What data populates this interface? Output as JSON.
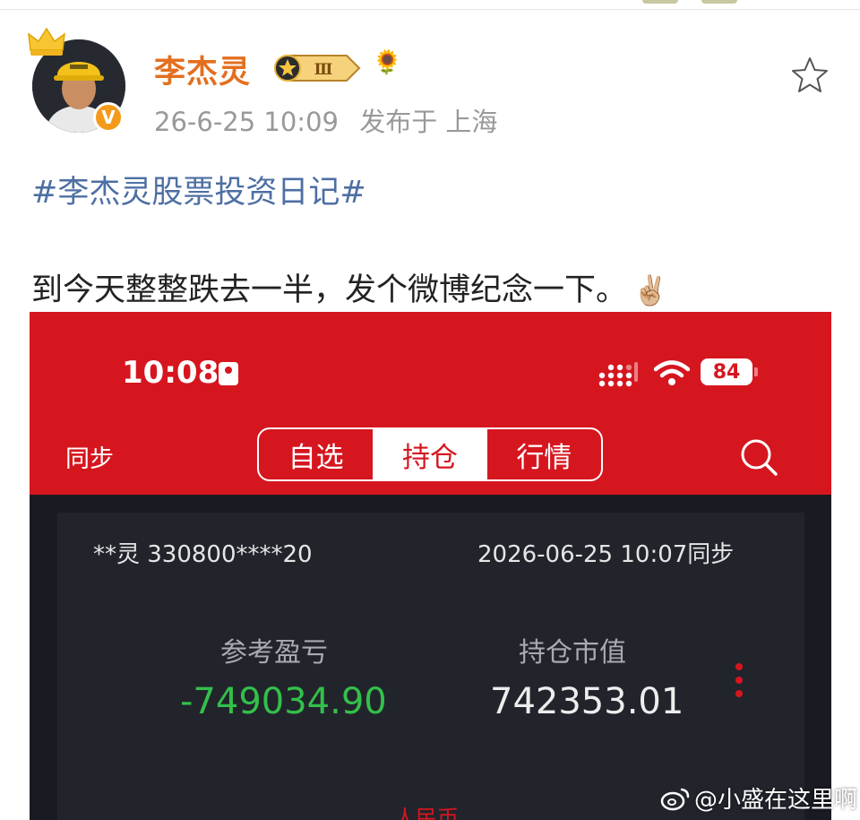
{
  "post": {
    "author": "李杰灵",
    "level": "Ⅲ",
    "verified_mark": "V",
    "timestamp": "26-6-25 10:09",
    "location": "发布于 上海",
    "hashtag": "#李杰灵股票投资日记#",
    "body": "到今天整整跌去一半，发个微博纪念一下。",
    "body_emoji": "✌🏼",
    "flower_emoji": "🌻"
  },
  "screenshot": {
    "status_time": "10:08",
    "battery": "84",
    "sync_label": "同步",
    "tabs": [
      {
        "label": "自选",
        "active": false
      },
      {
        "label": "持仓",
        "active": true
      },
      {
        "label": "行情",
        "active": false
      }
    ],
    "account": "**灵 330800****20",
    "sync_time": "2026-06-25 10:07同步",
    "pnl_label": "参考盈亏",
    "pnl_value": "-749034.90",
    "market_value_label": "持仓市值",
    "market_value": "742353.01",
    "currency": "人民币"
  },
  "watermark": "@小盛在这里啊",
  "colors": {
    "username": "#e36f1e",
    "hashtag": "#4d6fa3",
    "app_red": "#d6161f",
    "loss_green": "#33c04a",
    "panel_bg": "#22242c"
  },
  "icons": [
    "crown-icon",
    "verified-icon",
    "level-badge-icon",
    "star-icon",
    "signal-icon",
    "wifi-icon",
    "battery-icon",
    "search-icon",
    "more-icon",
    "weibo-logo-icon"
  ]
}
